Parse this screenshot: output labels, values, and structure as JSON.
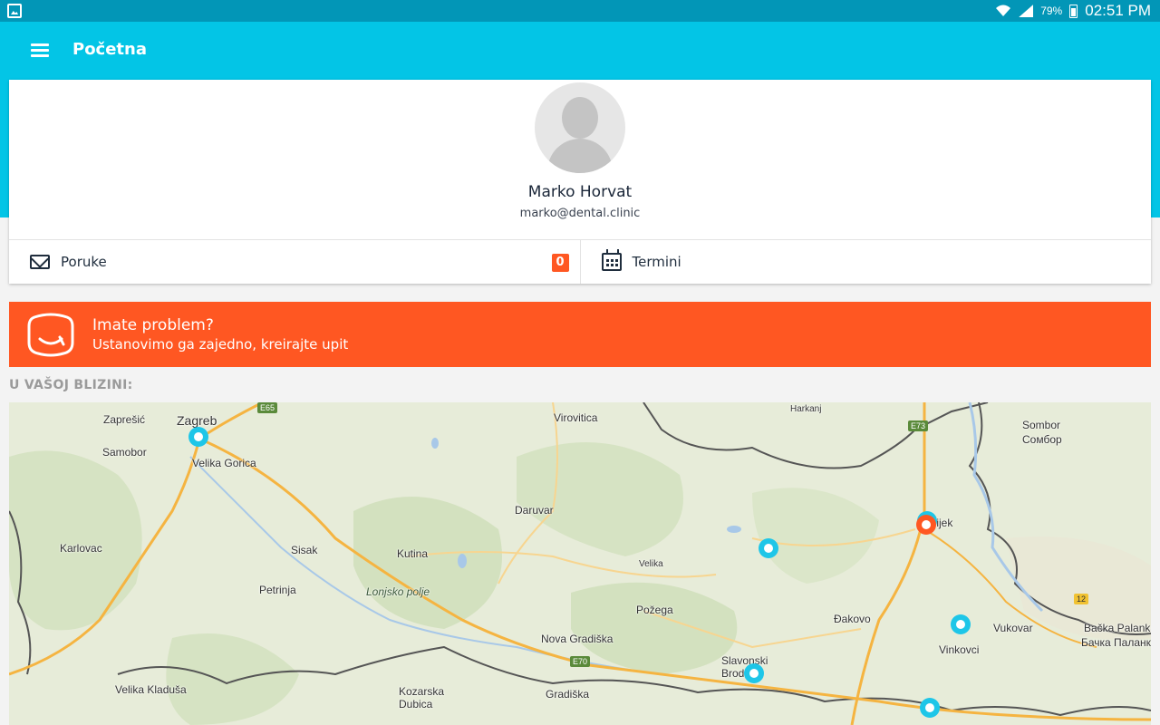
{
  "status_bar": {
    "battery": "79%",
    "time": "02:51 PM"
  },
  "app_bar": {
    "title": "Početna"
  },
  "profile": {
    "name": "Marko Horvat",
    "email": "marko@dental.clinic"
  },
  "actions": {
    "messages_label": "Poruke",
    "messages_count": "0",
    "appointments_label": "Termini"
  },
  "banner": {
    "title": "Imate problem?",
    "subtitle": "Ustanovimo ga zajedno, kreirajte upit"
  },
  "section": {
    "nearby_label": "U VAŠOJ BLIZINI:"
  },
  "map": {
    "places": [
      "Zaprešić",
      "Zagreb",
      "Samobor",
      "Velika Gorica",
      "Karlovac",
      "Sisak",
      "Petrinja",
      "Kutina",
      "Lonjsko polje",
      "Virovitica",
      "Daruvar",
      "Harkanj",
      "Sombor",
      "Сомбор",
      "Osijek",
      "Velika",
      "Požega",
      "Đakovo",
      "Vukovar",
      "Vinkovci",
      "Bačka Palanka",
      "Бачка Паланк",
      "Nova Gradiška",
      "Slavonski Brod",
      "Gradiška",
      "Kozarska Dubica",
      "Velika Kladuša"
    ],
    "roads": [
      "E65",
      "E73",
      "E70",
      "12"
    ],
    "pins_count": 7,
    "colors": {
      "pin": "#1ec6e8",
      "pin_active": "#ff5722"
    }
  },
  "colors": {
    "status_bar": "#0296b7",
    "app_bar": "#03c5e6",
    "accent": "#ff5722"
  }
}
